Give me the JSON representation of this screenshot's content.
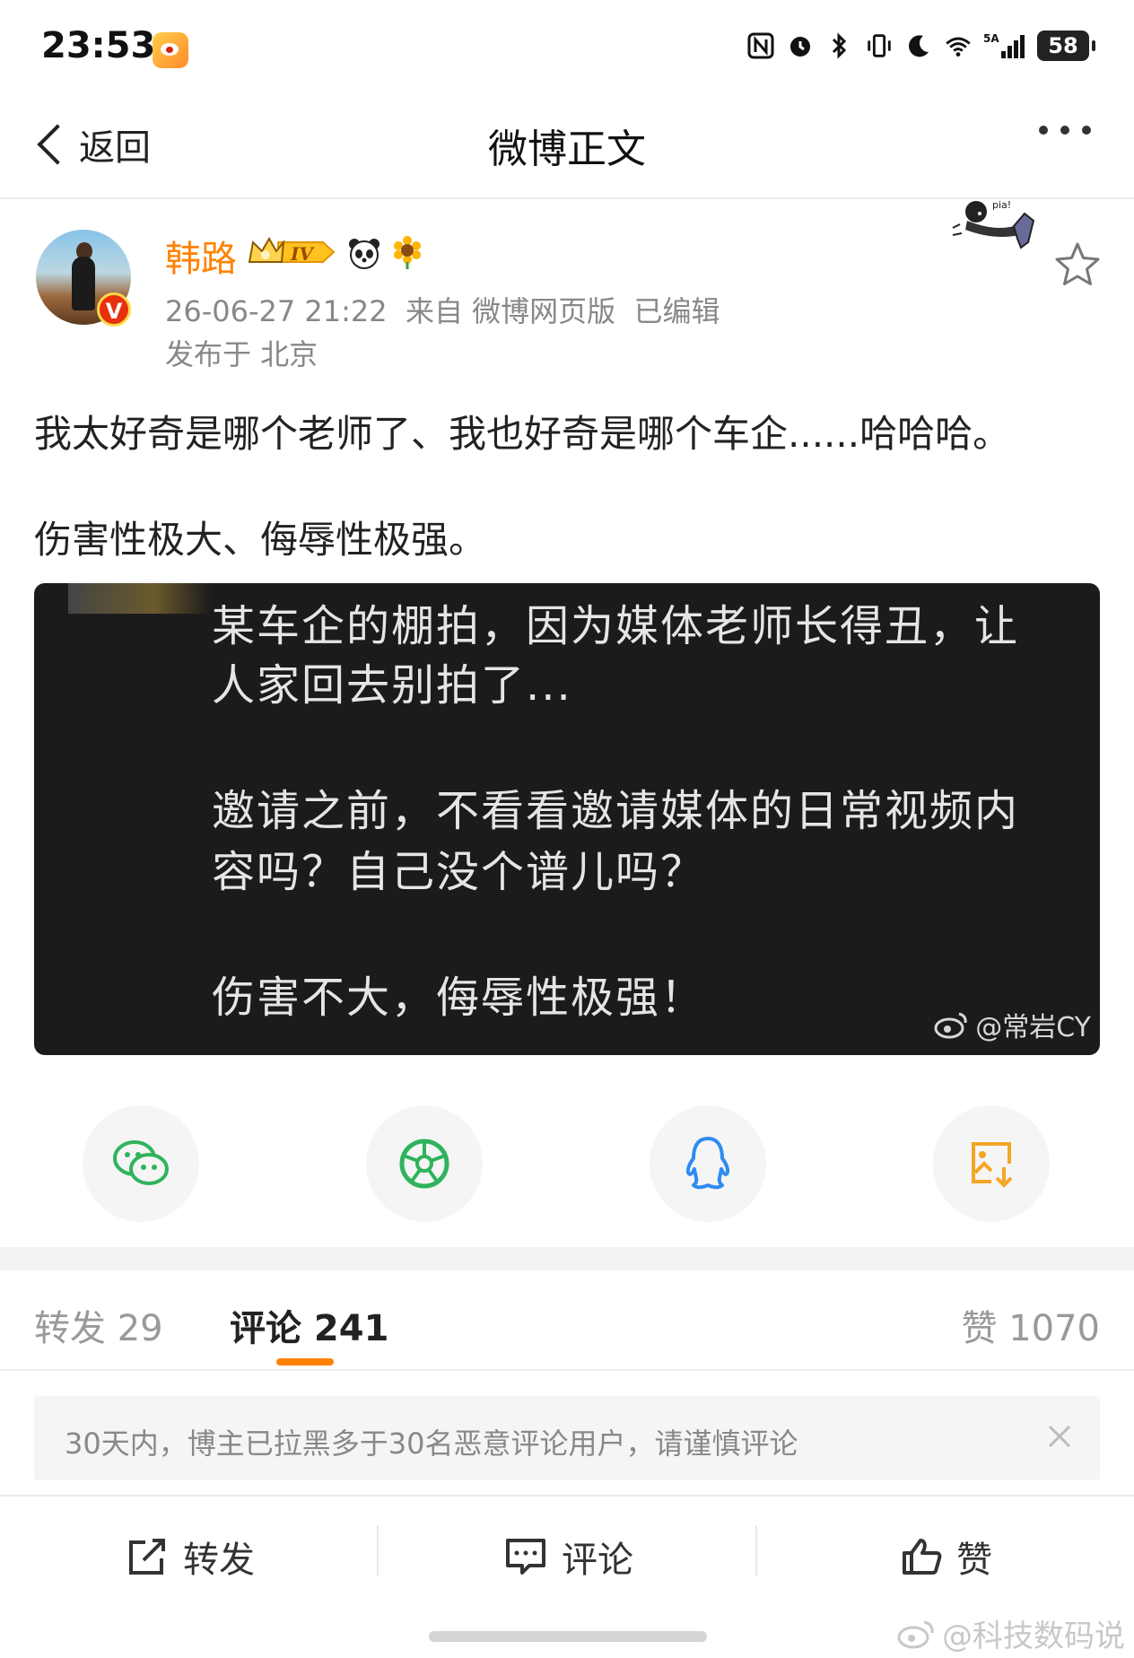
{
  "status_bar": {
    "time": "23:53",
    "battery": "58",
    "signal_label": "5A"
  },
  "nav": {
    "back_label": "返回",
    "title": "微博正文"
  },
  "post": {
    "author": "韩路",
    "level_badge": "IV",
    "timestamp": "26-06-27 21:22",
    "source": "来自 微博网页版",
    "edited": "已编辑",
    "location": "发布于 北京",
    "text_line1": "我太好奇是哪个老师了、我也好奇是哪个车企......哈哈哈。",
    "text_line2": "伤害性极大、侮辱性极强。",
    "image": {
      "line1": "某车企的棚拍，因为媒体老师长得丑，让",
      "line2": "人家回去别拍了...",
      "line3": "邀请之前，不看看邀请媒体的日常视频内",
      "line4": "容吗？自己没个谱儿吗？",
      "line5": "伤害不大，侮辱性极强！",
      "watermark": "@常岩CY"
    }
  },
  "share": {
    "icons": [
      "wechat-icon",
      "moments-icon",
      "qq-icon",
      "save-image-icon"
    ]
  },
  "tabs": {
    "repost": "转发 29",
    "comment": "评论 241",
    "like": "赞 1070"
  },
  "notice": {
    "text": "30天内，博主已拉黑多于30名恶意评论用户，请谨慎评论"
  },
  "actions": {
    "repost": "转发",
    "comment": "评论",
    "like": "赞"
  },
  "footer_watermark": "@科技数码说",
  "colors": {
    "accent": "#ff8200",
    "verified": "#e8300c",
    "image_bg": "#1b1b1b"
  }
}
